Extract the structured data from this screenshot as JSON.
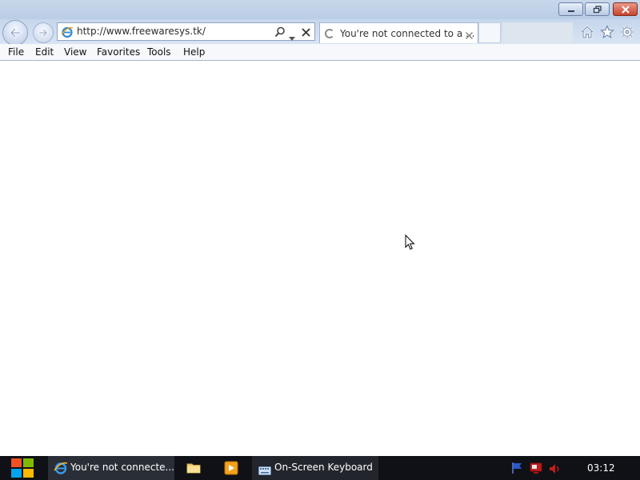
{
  "browser": {
    "address": "http://www.freewaresys.tk/",
    "tab_title": "You're not connected to a ...",
    "menu": [
      "File",
      "Edit",
      "View",
      "Favorites",
      "Tools",
      "Help"
    ]
  },
  "taskbar": {
    "ie_label": "You're not connecte...",
    "osk_label": "On-Screen Keyboard",
    "clock": "03:12"
  },
  "icons": {
    "back": "back-arrow-icon",
    "forward": "forward-arrow-icon",
    "site": "ie-icon",
    "search": "search-icon",
    "dropdown": "chevron-down-icon",
    "stop": "close-icon",
    "home": "home-icon",
    "favorites": "star-icon",
    "tools": "gear-icon"
  },
  "colors": {
    "chrome": "#c8d7ea",
    "taskbar": "#0f1116",
    "close_button": "#c8422c"
  }
}
